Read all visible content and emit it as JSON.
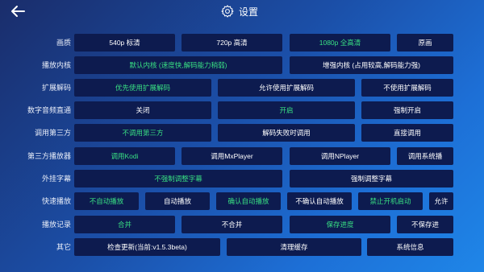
{
  "header": {
    "title": "设置",
    "back_icon": "arrow-left-icon",
    "gear_icon": "gear-icon"
  },
  "colors": {
    "selected": "#39e083",
    "normal": "#ffffff",
    "button_bg": "#0d1b4f"
  },
  "rows": [
    {
      "label": "画质",
      "options": [
        {
          "text": "540p 标清",
          "selected": false
        },
        {
          "text": "720p 高清",
          "selected": false
        },
        {
          "text": "1080p 全高清",
          "selected": true
        },
        {
          "text": "原画",
          "selected": false
        }
      ]
    },
    {
      "label": "播放内核",
      "options": [
        {
          "text": "默认内核 (速度快,解码能力稍弱)",
          "selected": true
        },
        {
          "text": "增强内核 (占用较高,解码能力强)",
          "selected": false
        }
      ]
    },
    {
      "label": "扩展解码",
      "options": [
        {
          "text": "优先使用扩展解码",
          "selected": true
        },
        {
          "text": "允许使用扩展解码",
          "selected": false
        },
        {
          "text": "不使用扩展解码",
          "selected": false
        }
      ]
    },
    {
      "label": "数字音频直通",
      "options": [
        {
          "text": "关闭",
          "selected": false
        },
        {
          "text": "开启",
          "selected": true
        },
        {
          "text": "强制开启",
          "selected": false
        }
      ]
    },
    {
      "label": "调用第三方",
      "options": [
        {
          "text": "不调用第三方",
          "selected": true
        },
        {
          "text": "解码失败时调用",
          "selected": false
        },
        {
          "text": "直接调用",
          "selected": false
        }
      ]
    },
    {
      "label": "第三方播放器",
      "options": [
        {
          "text": "调用Kodi",
          "selected": true
        },
        {
          "text": "调用MxPlayer",
          "selected": false
        },
        {
          "text": "调用NPlayer",
          "selected": false
        },
        {
          "text": "调用系统播",
          "selected": false
        }
      ]
    },
    {
      "label": "外挂字幕",
      "options": [
        {
          "text": "不强制调整字幕",
          "selected": true
        },
        {
          "text": "强制调整字幕",
          "selected": false
        }
      ]
    },
    {
      "label": "快速播放",
      "options": [
        {
          "text": "不自动播放",
          "selected": true
        },
        {
          "text": "自动播放",
          "selected": false
        },
        {
          "text": "确认自动播放",
          "selected": true
        },
        {
          "text": "不确认自动播放",
          "selected": false
        },
        {
          "text": "禁止开机启动",
          "selected": true
        },
        {
          "text": "允许",
          "selected": false
        }
      ]
    },
    {
      "label": "播放记录",
      "options": [
        {
          "text": "合并",
          "selected": true
        },
        {
          "text": "不合并",
          "selected": false
        },
        {
          "text": "保存进度",
          "selected": true
        },
        {
          "text": "不保存进",
          "selected": false
        }
      ]
    },
    {
      "label": "其它",
      "options": [
        {
          "text": "检查更新(当前:v1.5.3beta)",
          "selected": false
        },
        {
          "text": "清理缓存",
          "selected": false
        },
        {
          "text": "系统信息",
          "selected": false
        }
      ]
    }
  ]
}
